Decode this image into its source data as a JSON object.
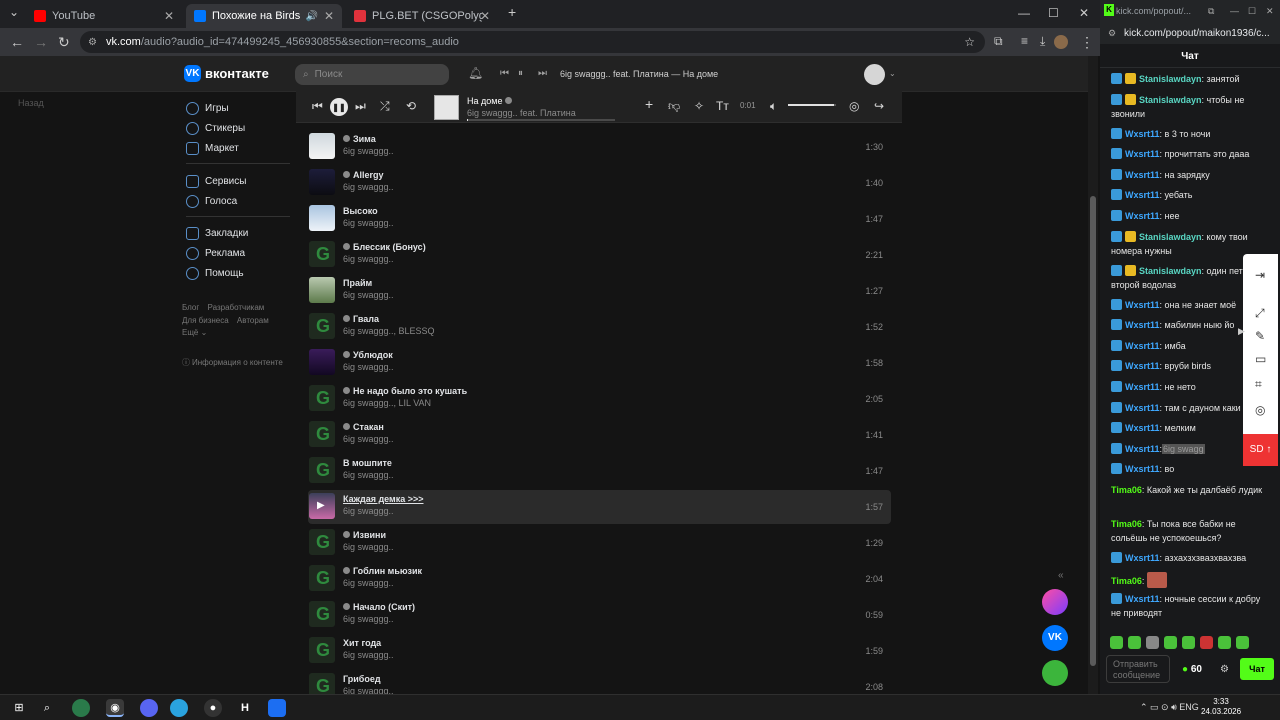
{
  "browser": {
    "tabs": [
      {
        "title": "YouTube",
        "color": "#ff0000"
      },
      {
        "title": "Похожие на Birds",
        "color": "#0077ff"
      },
      {
        "title": "PLG.BET (CSGOPolygon) – Онл",
        "color": "#e0323c"
      }
    ],
    "url_lead": "vk.com",
    "url_tail": "/audio?audio_id=474499245_456930855&section=recoms_audio"
  },
  "vk": {
    "logo_text": "вконтакте",
    "search_placeholder": "Поиск",
    "header_track": "6ig swaggg.. feat. Платина — На доме",
    "news_back": "Назад",
    "sidebar": [
      {
        "label": "Игры",
        "icon": "games-icon"
      },
      {
        "label": "Стикеры",
        "icon": "stickers-icon"
      },
      {
        "label": "Маркет",
        "icon": "market-icon"
      },
      {
        "label": "Сервисы",
        "icon": "services-icon"
      },
      {
        "label": "Голоса",
        "icon": "votes-icon"
      },
      {
        "label": "Закладки",
        "icon": "bookmarks-icon"
      },
      {
        "label": "Реклама",
        "icon": "ads-icon"
      },
      {
        "label": "Помощь",
        "icon": "help-icon"
      }
    ],
    "footer_links": [
      "Блог",
      "Разработчикам",
      "Для бизнеса",
      "Авторам",
      "Ещё ⌄"
    ],
    "content_info": "Информация о контенте",
    "player": {
      "title": "На доме",
      "artist": "6ig swaggg.. feat. Платина",
      "time": "0:01",
      "progress": 0.01,
      "volume": 0.95
    },
    "tracks": [
      {
        "name": "Зима",
        "artist": "6ig swaggg..",
        "duration": "1:30",
        "explicit": true,
        "cover": "cvW"
      },
      {
        "name": "Allergy",
        "artist": "6ig swaggg..",
        "duration": "1:40",
        "explicit": true,
        "cover": "cvD"
      },
      {
        "name": "Высоко",
        "artist": "6ig swaggg..",
        "duration": "1:47",
        "explicit": false,
        "cover": "cvS"
      },
      {
        "name": "Блессик (Бонус)",
        "artist": "6ig swaggg..",
        "duration": "2:21",
        "explicit": true,
        "cover": "cvG"
      },
      {
        "name": "Прайм",
        "artist": "6ig swaggg..",
        "duration": "1:27",
        "explicit": false,
        "cover": "cvL"
      },
      {
        "name": "Гвала",
        "artist": "6ig swaggg.., BLESSQ",
        "duration": "1:52",
        "explicit": true,
        "cover": "cvG"
      },
      {
        "name": "Ублюдок",
        "artist": "6ig swaggg..",
        "duration": "1:58",
        "explicit": true,
        "cover": "cvP"
      },
      {
        "name": "Не надо было это кушать",
        "artist": "6ig swaggg.., LIL VAN",
        "duration": "2:05",
        "explicit": true,
        "cover": "cvG"
      },
      {
        "name": "Стакан",
        "artist": "6ig swaggg..",
        "duration": "1:41",
        "explicit": true,
        "cover": "cvG"
      },
      {
        "name": "В мошпите",
        "artist": "6ig swaggg..",
        "duration": "1:47",
        "explicit": false,
        "cover": "cvG"
      },
      {
        "name": "Каждая демка >>>",
        "artist": "6ig swaggg..",
        "duration": "1:57",
        "explicit": false,
        "cover": "cvK",
        "hover": true
      },
      {
        "name": "Извини",
        "artist": "6ig swaggg..",
        "duration": "1:29",
        "explicit": true,
        "cover": "cvG"
      },
      {
        "name": "Гоблин мьюзик",
        "artist": "6ig swaggg..",
        "duration": "2:04",
        "explicit": true,
        "cover": "cvG"
      },
      {
        "name": "Начало (Скит)",
        "artist": "6ig swaggg..",
        "duration": "0:59",
        "explicit": true,
        "cover": "cvG"
      },
      {
        "name": "Хит года",
        "artist": "6ig swaggg..",
        "duration": "1:59",
        "explicit": false,
        "cover": "cvG"
      },
      {
        "name": "Грибоед",
        "artist": "6ig swaggg..",
        "duration": "2:08",
        "explicit": false,
        "cover": "cvG"
      }
    ]
  },
  "kick": {
    "tab_title": "kick.com/popout/...",
    "url": "kick.com/popout/maikon1936/c...",
    "header": "Чат",
    "messages": [
      {
        "user": "Stanislawdayn",
        "text": ": занятой",
        "color": "#59d6c3",
        "badge": true
      },
      {
        "user": "Stanislawdayn",
        "text": ": чтобы не звонили",
        "color": "#59d6c3",
        "badge": true
      },
      {
        "user": "Wxsrt11",
        "text": ": в 3 то ночи",
        "color": "#3ea8ff",
        "badge": true
      },
      {
        "user": "Wxsrt11",
        "text": ": прочиттать это дааа",
        "color": "#3ea8ff",
        "badge": true
      },
      {
        "user": "Wxsrt11",
        "text": ": на зарядку",
        "color": "#3ea8ff",
        "badge": true
      },
      {
        "user": "Wxsrt11",
        "text": ": уебать",
        "color": "#3ea8ff",
        "badge": true
      },
      {
        "user": "Wxsrt11",
        "text": ": нее",
        "color": "#3ea8ff",
        "badge": true
      },
      {
        "user": "Stanislawdayn",
        "text": ": кому твои номера нужны",
        "color": "#59d6c3",
        "badge": true
      },
      {
        "user": "Stanislawdayn",
        "text": ": один пет второй водолаз",
        "color": "#59d6c3",
        "badge": true
      },
      {
        "user": "Wxsrt11",
        "text": ": она не знает моё",
        "color": "#3ea8ff",
        "badge": true
      },
      {
        "user": "Wxsrt11",
        "text": ": мабилин ныю йо",
        "color": "#3ea8ff",
        "badge": true
      },
      {
        "user": "Wxsrt11",
        "text": ": имба",
        "color": "#3ea8ff",
        "badge": true
      },
      {
        "user": "Wxsrt11",
        "text": ": вруби birds",
        "color": "#3ea8ff",
        "badge": true
      },
      {
        "user": "Wxsrt11",
        "text": ": не нето",
        "color": "#3ea8ff",
        "badge": true
      },
      {
        "user": "Wxsrt11",
        "text": ": там с дауном каки",
        "color": "#3ea8ff",
        "badge": true
      },
      {
        "user": "Wxsrt11",
        "text": ": мелким",
        "color": "#3ea8ff",
        "badge": true
      },
      {
        "user": "Wxsrt11",
        "text": ":",
        "highlight": "6ig swagg",
        "color": "#3ea8ff",
        "badge": true
      },
      {
        "user": "Wxsrt11",
        "text": ": во",
        "color": "#3ea8ff",
        "badge": true
      },
      {
        "user": "Tima06",
        "text": ": Какой же ты далбаёб лудик",
        "color": "#53fc18",
        "badge": false
      },
      {
        "user": "Tima06",
        "text": ": Ты пока все бабки не сольёшь не успокоешься?",
        "color": "#53fc18",
        "badge": false
      },
      {
        "user": "Wxsrt11",
        "text": ": азхахзхзвазхвахзва",
        "color": "#3ea8ff",
        "badge": true
      },
      {
        "user": "Tima06",
        "text": ":",
        "color": "#53fc18",
        "badge": false
      },
      {
        "user": "Wxsrt11",
        "text": ": ночные сессии к добру не приводят",
        "color": "#3ea8ff",
        "badge": true
      }
    ],
    "input_placeholder": "Отправить сообщение",
    "count": "60",
    "send_label": "Чат",
    "sd_label": "SD"
  },
  "taskbar": {
    "lang": "ENG",
    "time": "3:33",
    "date": "24.03.2026"
  }
}
